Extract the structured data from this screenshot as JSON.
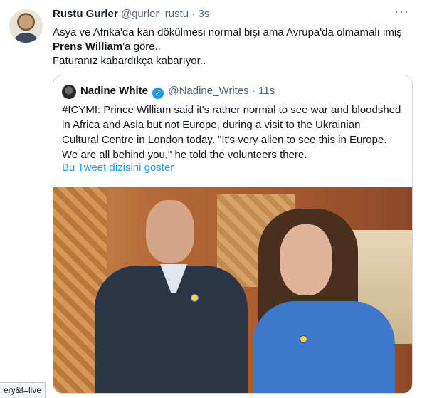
{
  "tweet": {
    "display_name": "Rustu Gurler",
    "handle": "@gurler_rustu",
    "separator": "·",
    "time": "3s",
    "more": "···",
    "line1": "Asya ve Afrika'da kan dökülmesi normal bişi ama Avrupa'da olmamalı imiş",
    "line2_bold": "Prens William",
    "line2_rest": "'a göre..",
    "line3": "Faturanız kabardıkça kabarıyor.."
  },
  "quoted": {
    "display_name": "Nadine White",
    "verified_glyph": "✓",
    "handle": "@Nadine_Writes",
    "separator": "·",
    "time": "11s",
    "line1": "#ICYMI: Prince William said it's rather normal to see war and bloodshed",
    "line2": "in Africa and Asia but not Europe, during a visit to the Ukrainian",
    "line3": "Cultural Centre in London today. \"It's very alien to see this in Europe.",
    "line4": "We are all behind you,\" he told the volunteers there.",
    "show_thread": "Bu Tweet dizisini göster"
  },
  "browser": {
    "status_url": "ery&f=live"
  },
  "colors": {
    "link": "#1d9bf0",
    "secondary_text": "#536471",
    "border": "#cfd9de"
  }
}
